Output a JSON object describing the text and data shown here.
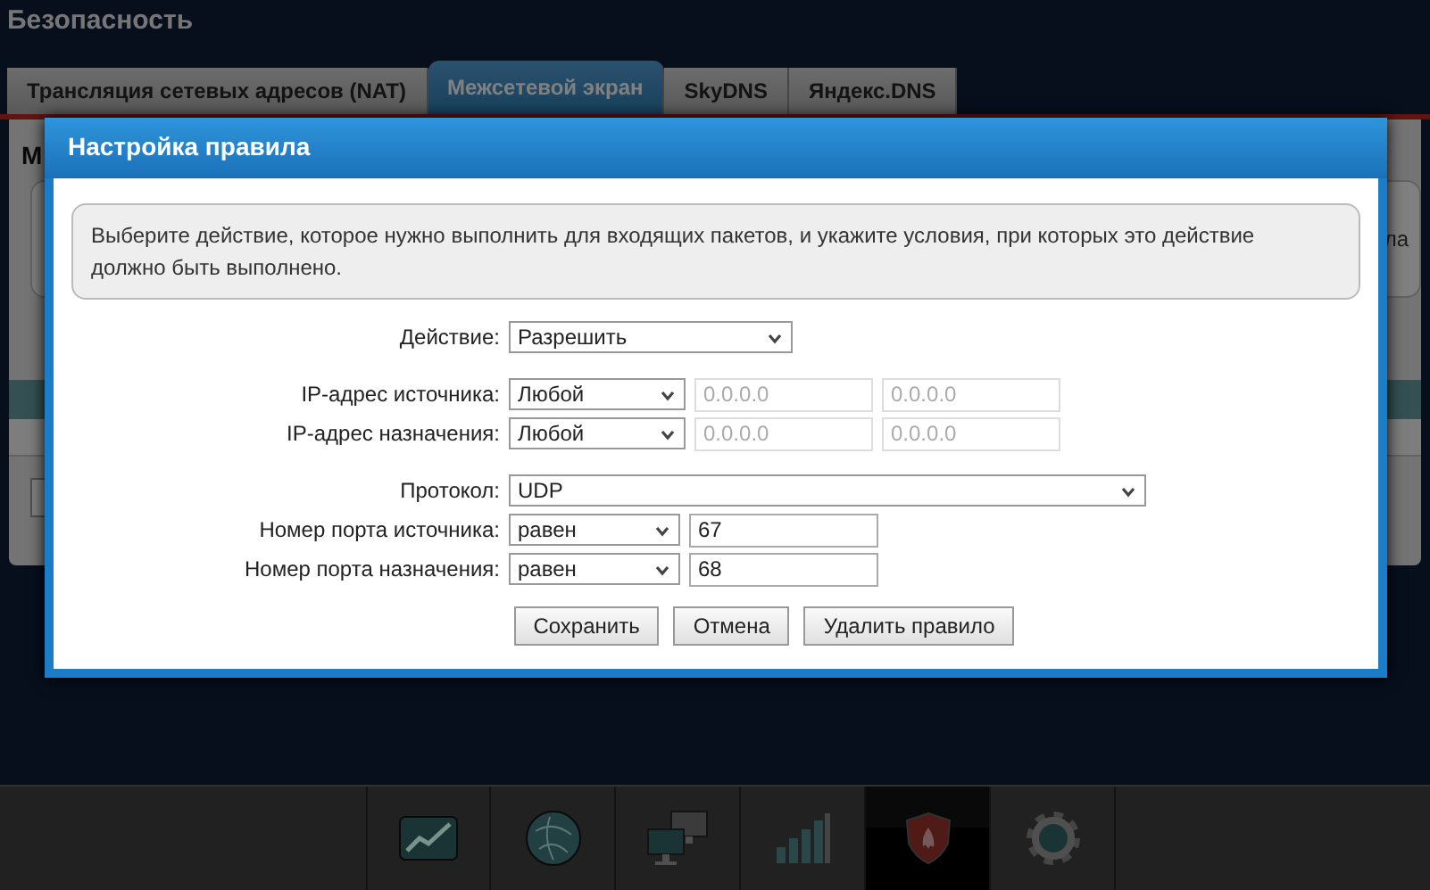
{
  "page_title": "Безопасность",
  "tabs": [
    {
      "label": "Трансляция сетевых адресов (NAT)",
      "selected": false
    },
    {
      "label": "Межсетевой экран",
      "selected": true
    },
    {
      "label": "SkyDNS",
      "selected": false
    },
    {
      "label": "Яндекс.DNS",
      "selected": false
    }
  ],
  "background": {
    "heading": "М",
    "box_text": "ла"
  },
  "dialog": {
    "title": "Настройка правила",
    "info": "Выберите действие, которое нужно выполнить для входящих пакетов, и укажите условия, при которых это действие должно быть выполнено.",
    "field_groups": [
      [
        {
          "kind": "select",
          "label": "Действие:",
          "value": "Разрешить"
        }
      ],
      [
        {
          "kind": "address",
          "label": "IP-адрес источника:",
          "value": "Любой",
          "start": "0.0.0.0",
          "end": "0.0.0.0",
          "disabled": true
        },
        {
          "kind": "address",
          "label": "IP-адрес назначения:",
          "value": "Любой",
          "start": "0.0.0.0",
          "end": "0.0.0.0",
          "disabled": true
        }
      ],
      [
        {
          "kind": "wide",
          "label": "Протокол:",
          "value": "UDP"
        },
        {
          "kind": "port",
          "label": "Номер порта источника:",
          "value": "равен",
          "port": "67"
        },
        {
          "kind": "port",
          "label": "Номер порта назначения:",
          "value": "равен",
          "port": "68"
        }
      ]
    ],
    "buttons": [
      "Сохранить",
      "Отмена",
      "Удалить правило"
    ]
  },
  "nav": [
    {
      "selected": false
    },
    {
      "selected": false
    },
    {
      "selected": false
    },
    {
      "selected": false
    },
    {
      "selected": true
    },
    {
      "selected": false
    }
  ]
}
